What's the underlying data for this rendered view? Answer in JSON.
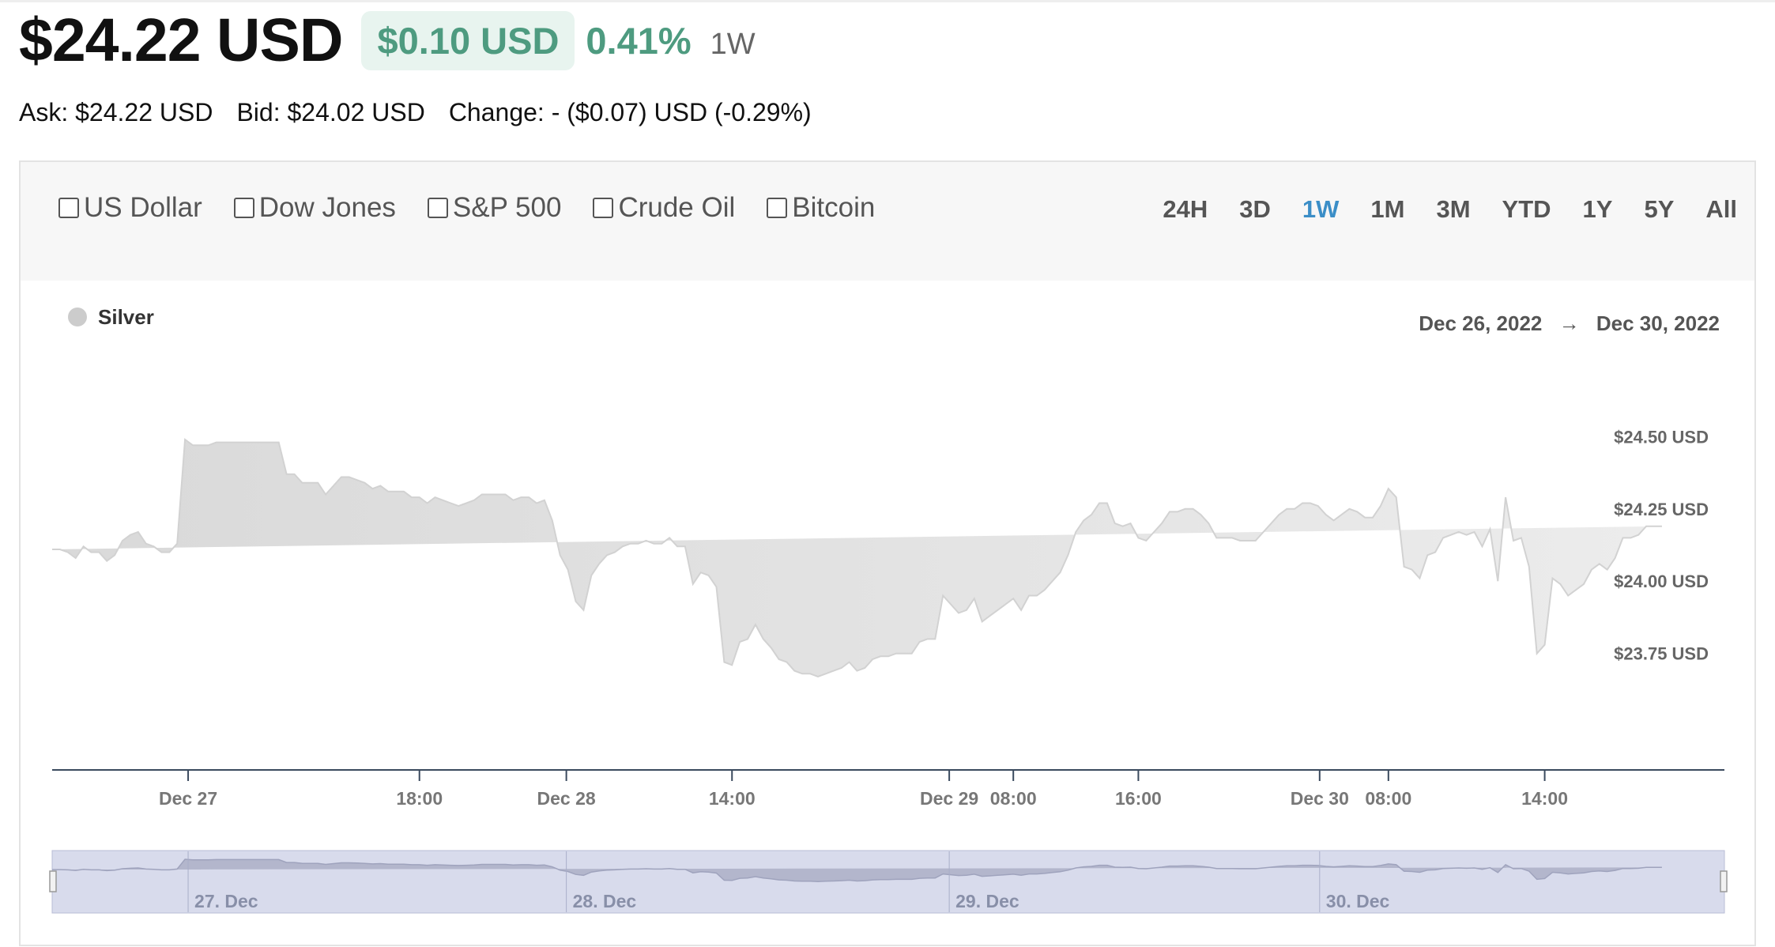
{
  "quote": {
    "price": "$24.22 USD",
    "change_amount": "$0.10 USD",
    "change_percent": "0.41%",
    "period": "1W",
    "ask": "Ask: $24.22 USD",
    "bid": "Bid: $24.02 USD",
    "change_line": "Change: - ($0.07) USD (-0.29%)",
    "colors": {
      "up": "#4e9b80",
      "badge_bg": "#e8f4ef"
    }
  },
  "compare": [
    {
      "label": "US Dollar",
      "checked": false
    },
    {
      "label": "Dow Jones",
      "checked": false
    },
    {
      "label": "S&P 500",
      "checked": false
    },
    {
      "label": "Crude Oil",
      "checked": false
    },
    {
      "label": "Bitcoin",
      "checked": false
    }
  ],
  "ranges": [
    {
      "label": "24H",
      "active": false
    },
    {
      "label": "3D",
      "active": false
    },
    {
      "label": "1W",
      "active": true
    },
    {
      "label": "1M",
      "active": false
    },
    {
      "label": "3M",
      "active": false
    },
    {
      "label": "YTD",
      "active": false
    },
    {
      "label": "1Y",
      "active": false
    },
    {
      "label": "5Y",
      "active": false
    },
    {
      "label": "All",
      "active": false
    }
  ],
  "date_range": {
    "from": "Dec 26, 2022",
    "arrow": "→",
    "to": "Dec 30, 2022"
  },
  "chart_data": {
    "type": "area",
    "title": "",
    "legend": [
      {
        "name": "Silver",
        "color": "#cccccc"
      }
    ],
    "x_domain_hours": [
      -5.5,
      101.5
    ],
    "ylim": [
      23.35,
      24.52
    ],
    "y_ticks": [
      {
        "value": 24.5,
        "label": "$24.50 USD"
      },
      {
        "value": 24.25,
        "label": "$24.25 USD"
      },
      {
        "value": 24.0,
        "label": "$24.00 USD"
      },
      {
        "value": 23.75,
        "label": "$23.75 USD"
      }
    ],
    "x_ticks": [
      {
        "h": 3.2,
        "label": "Dec 27"
      },
      {
        "h": 18,
        "label": "18:00"
      },
      {
        "h": 27.4,
        "label": "Dec 28"
      },
      {
        "h": 38,
        "label": "14:00"
      },
      {
        "h": 51.9,
        "label": "Dec 29"
      },
      {
        "h": 56,
        "label": "08:00"
      },
      {
        "h": 64,
        "label": "16:00"
      },
      {
        "h": 75.6,
        "label": "Dec 30"
      },
      {
        "h": 80,
        "label": "08:00"
      },
      {
        "h": 90,
        "label": "14:00"
      }
    ],
    "navigator_labels": [
      {
        "h": 3.2,
        "label": "27. Dec"
      },
      {
        "h": 27.4,
        "label": "28. Dec"
      },
      {
        "h": 51.9,
        "label": "29. Dec"
      },
      {
        "h": 75.6,
        "label": "30. Dec"
      }
    ],
    "x_hours": [
      -5.5,
      -5,
      -4.5,
      -4,
      -3.5,
      -3,
      -2.5,
      -2,
      -1.5,
      -1,
      -0.5,
      0,
      0.5,
      1,
      1.5,
      2,
      2.5,
      3,
      3.5,
      4,
      4.5,
      5,
      5.5,
      6,
      6.5,
      7,
      7.5,
      8,
      8.5,
      9,
      9.5,
      10,
      10.5,
      11,
      11.5,
      12,
      12.5,
      13,
      13.5,
      14,
      14.5,
      15,
      15.5,
      16,
      16.5,
      17,
      17.5,
      18,
      18.5,
      19,
      19.5,
      20,
      20.5,
      21,
      21.5,
      22,
      22.5,
      23,
      23.5,
      24,
      24.5,
      25,
      25.5,
      26,
      26.5,
      27,
      27.5,
      28,
      28.5,
      29,
      29.5,
      30,
      30.5,
      31,
      31.5,
      32,
      32.5,
      33,
      33.5,
      34,
      34.5,
      35,
      35.5,
      36,
      36.5,
      37,
      37.5,
      38,
      38.5,
      39,
      39.5,
      40,
      40.5,
      41,
      41.5,
      42,
      42.5,
      43,
      43.5,
      44,
      44.5,
      45,
      45.5,
      46,
      46.5,
      47,
      47.5,
      48,
      48.5,
      49,
      49.5,
      50,
      50.5,
      51,
      51.5,
      52,
      52.5,
      53,
      53.5,
      54,
      54.5,
      55,
      55.5,
      56,
      56.5,
      57,
      57.5,
      58,
      58.5,
      59,
      59.5,
      60,
      60.5,
      61,
      61.5,
      62,
      62.5,
      63,
      63.5,
      64,
      64.5,
      65,
      65.5,
      66,
      66.5,
      67,
      67.5,
      68,
      68.5,
      69,
      69.5,
      70,
      70.5,
      71,
      71.5,
      72,
      72.5,
      73,
      73.5,
      74,
      74.5,
      75,
      75.5,
      76,
      76.5,
      77,
      77.5,
      78,
      78.5,
      79,
      79.5,
      80,
      80.5,
      81,
      81.5,
      82,
      82.5,
      83,
      83.5,
      84,
      84.5,
      85,
      85.5,
      86,
      86.5,
      87,
      87.5,
      88,
      88.5,
      89,
      89.5,
      90,
      90.5,
      91,
      91.5,
      92,
      92.5,
      93,
      93.5,
      94,
      94.5,
      95,
      95.5,
      96,
      96.5,
      97,
      97.5,
      98,
      98.5,
      99,
      99.5,
      100,
      100.5,
      101,
      101.5
    ],
    "series": [
      {
        "name": "Silver",
        "values": [
          24.11,
          24.11,
          24.1,
          24.08,
          24.12,
          24.1,
          24.1,
          24.07,
          24.09,
          24.14,
          24.16,
          24.17,
          24.13,
          24.12,
          24.1,
          24.1,
          24.13,
          24.49,
          24.47,
          24.47,
          24.47,
          24.48,
          24.48,
          24.48,
          24.48,
          24.48,
          24.48,
          24.48,
          24.48,
          24.48,
          24.37,
          24.37,
          24.34,
          24.34,
          24.34,
          24.3,
          24.33,
          24.36,
          24.36,
          24.35,
          24.34,
          24.32,
          24.33,
          24.31,
          24.31,
          24.31,
          24.29,
          24.29,
          24.27,
          24.29,
          24.28,
          24.27,
          24.26,
          24.27,
          24.28,
          24.3,
          24.3,
          24.3,
          24.3,
          24.28,
          24.29,
          24.29,
          24.27,
          24.28,
          24.21,
          24.09,
          24.04,
          23.93,
          23.9,
          24.02,
          24.06,
          24.09,
          24.1,
          24.12,
          24.13,
          24.13,
          24.14,
          24.13,
          24.13,
          24.15,
          24.12,
          24.12,
          23.99,
          24.03,
          24.02,
          23.98,
          23.72,
          23.71,
          23.79,
          23.8,
          23.85,
          23.8,
          23.77,
          23.73,
          23.72,
          23.69,
          23.68,
          23.68,
          23.67,
          23.68,
          23.69,
          23.7,
          23.72,
          23.69,
          23.7,
          23.73,
          23.74,
          23.74,
          23.75,
          23.75,
          23.75,
          23.79,
          23.8,
          23.8,
          23.95,
          23.92,
          23.89,
          23.9,
          23.94,
          23.86,
          23.88,
          23.9,
          23.92,
          23.94,
          23.9,
          23.95,
          23.95,
          23.97,
          24.0,
          24.03,
          24.09,
          24.17,
          24.21,
          24.23,
          24.27,
          24.27,
          24.2,
          24.19,
          24.2,
          24.15,
          24.14,
          24.17,
          24.2,
          24.24,
          24.24,
          24.25,
          24.25,
          24.23,
          24.2,
          24.15,
          24.15,
          24.15,
          24.14,
          24.14,
          24.14,
          24.17,
          24.2,
          24.23,
          24.25,
          24.25,
          24.27,
          24.27,
          24.26,
          24.23,
          24.21,
          24.23,
          24.25,
          24.24,
          24.22,
          24.22,
          24.26,
          24.32,
          24.29,
          24.05,
          24.04,
          24.01,
          24.09,
          24.1,
          24.15,
          24.16,
          24.17,
          24.16,
          24.17,
          24.12,
          24.18,
          24.0,
          24.29,
          24.14,
          24.15,
          24.05,
          23.75,
          23.78,
          24.01,
          23.99,
          23.95,
          23.97,
          23.99,
          24.04,
          24.06,
          24.04,
          24.08,
          24.15,
          24.15,
          24.16,
          24.19,
          24.19,
          24.19
        ]
      }
    ]
  }
}
